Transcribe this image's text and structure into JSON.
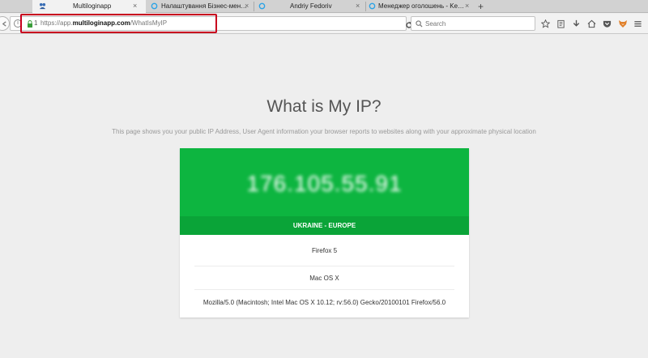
{
  "browser": {
    "tabs": [
      {
        "title": "Multiloginapp",
        "active": true
      },
      {
        "title": "Налаштування Бізнес-мен…",
        "active": false
      },
      {
        "title": "Andriy Fedoriv",
        "active": false
      },
      {
        "title": "Менеджер оголошень - Ke…",
        "active": false
      }
    ],
    "new_tab": "+",
    "close_glyph": "×"
  },
  "navbar": {
    "permission_count": "1",
    "url_prefix": "https://app.",
    "url_domain": "multiloginapp.com",
    "url_path": "/WhatIsMyIP",
    "search_placeholder": "Search"
  },
  "page": {
    "title": "What is My IP?",
    "subtitle": "This page shows you your public IP Address, User Agent information your browser reports to websites along with your approximate physical location",
    "ip": "176.105.55.91",
    "region": "UKRAINE - EUROPE",
    "browser_name": "Firefox 5",
    "os": "Mac OS X",
    "user_agent": "Mozilla/5.0 (Macintosh; Intel Mac OS X 10.12; rv:56.0) Gecko/20100101 Firefox/56.0"
  },
  "colors": {
    "accent_green": "#0db540",
    "band_green": "#0aa438",
    "highlight_red": "#c8001e"
  }
}
